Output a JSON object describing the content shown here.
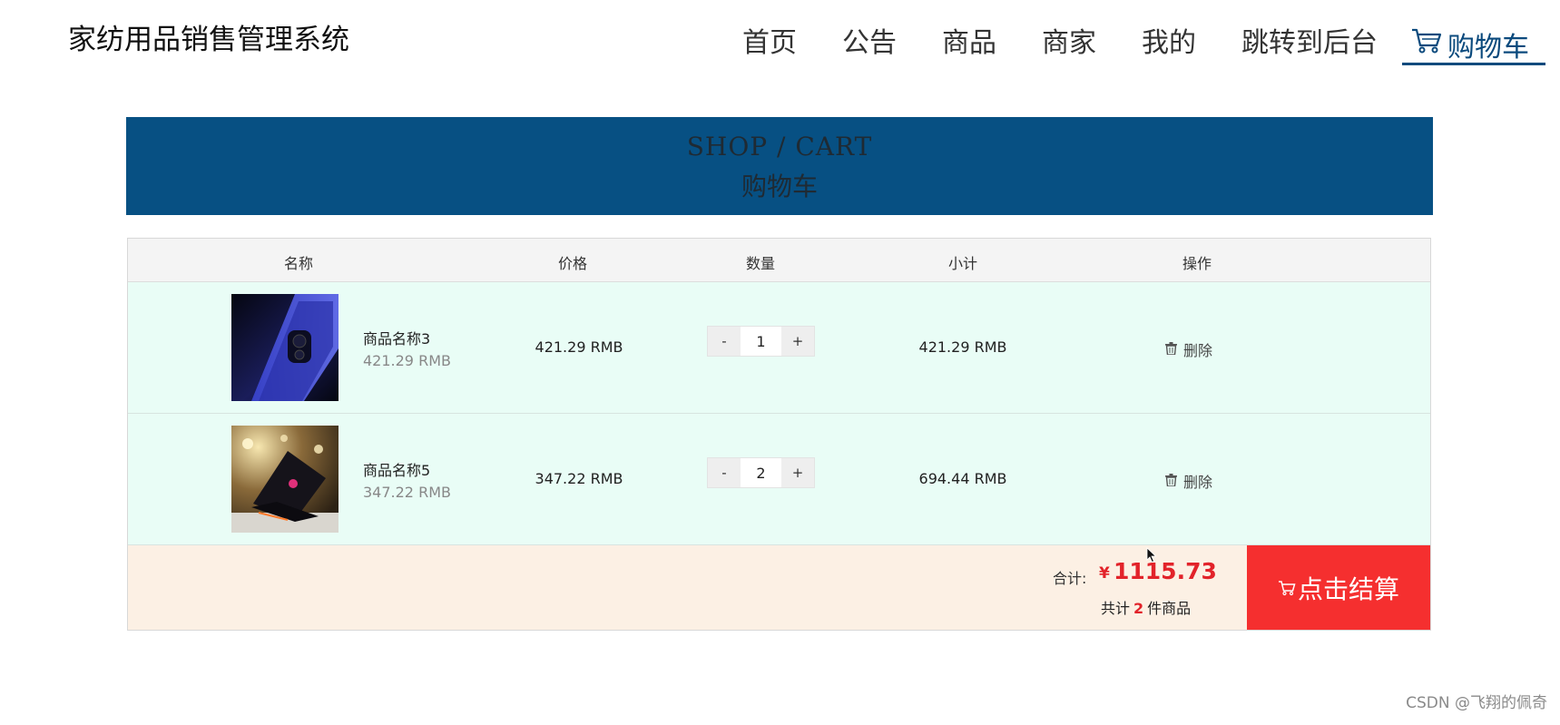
{
  "header": {
    "site_title": "家纺用品销售管理系统",
    "nav": [
      "首页",
      "公告",
      "商品",
      "商家",
      "我的",
      "跳转到后台"
    ],
    "cart_label": "购物车"
  },
  "banner": {
    "title_en": "SHOP / CART",
    "title_cn": "购物车"
  },
  "table": {
    "headers": [
      "名称",
      "价格",
      "数量",
      "小计",
      "操作"
    ],
    "rows": [
      {
        "name": "商品名称3",
        "sub_price": "421.29 RMB",
        "price": "421.29 RMB",
        "qty": "1",
        "subtotal": "421.29 RMB",
        "action": "删除",
        "image": "blue-phone-image"
      },
      {
        "name": "商品名称5",
        "sub_price": "347.22 RMB",
        "price": "347.22 RMB",
        "qty": "2",
        "subtotal": "694.44 RMB",
        "action": "删除",
        "image": "laptop-image"
      }
    ],
    "qty_minus": "-",
    "qty_plus": "+"
  },
  "summary": {
    "total_label": "合计:",
    "currency": "¥",
    "total": "1115.73",
    "count_prefix": "共计",
    "count": "2",
    "count_suffix": "件商品",
    "checkout_label": "点击结算"
  },
  "watermark": "CSDN @飞翔的佩奇",
  "colors": {
    "banner": "#075083",
    "accent_red": "#f52f2f",
    "row_bg": "#e9fdf6",
    "footer_bg": "#fcf0e4",
    "nav_active": "#0b4a7d"
  },
  "icons": {
    "cart": "shopping-cart-icon",
    "delete": "trash-icon"
  }
}
